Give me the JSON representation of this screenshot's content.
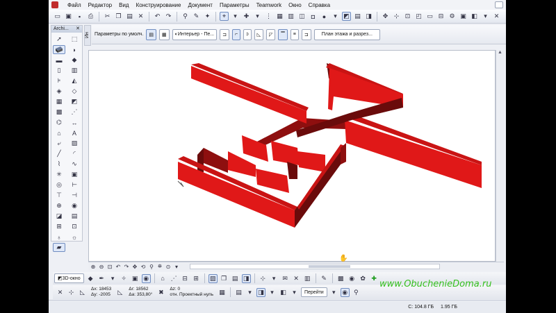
{
  "menu": [
    "Файл",
    "Редактор",
    "Вид",
    "Конструирование",
    "Документ",
    "Параметры",
    "Teamwork",
    "Окно",
    "Справка"
  ],
  "toolbox_title": "Archi...",
  "info_side_label": "Ин",
  "infobar": {
    "default_params": "Параметры по умолч.",
    "interior_label": "Интерьер - Пе...",
    "plan_button": "План этажа и разрез..."
  },
  "bottom": {
    "view_3d": "3D-окно",
    "dx": "Δx: 18453",
    "dy": "Δy: -2005",
    "dr": "Δr: 18562",
    "da": "Δa: 353,80°",
    "dz": "Δz: 0",
    "ref": "отн. Проектный нуль",
    "go": "Перейти"
  },
  "status": {
    "c_disk": "C: 104.8 ГБ",
    "mem": "1.95 ГБ"
  },
  "watermark": "www.ObuchenieDoma.ru",
  "colors": {
    "wall_top": "#c91414",
    "wall_front": "#e01818",
    "wall_side": "#6a0b0b",
    "wall_dark": "#8e0f0f"
  }
}
